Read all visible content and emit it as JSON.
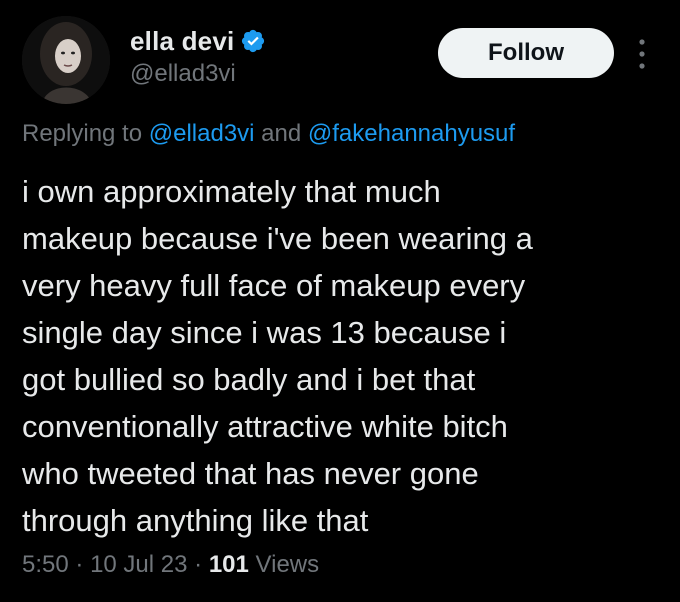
{
  "user": {
    "display_name": "ella devi",
    "handle": "@ellad3vi",
    "verified": true
  },
  "follow_label": "Follow",
  "reply_context": {
    "prefix": "Replying to",
    "mention_1": "@ellad3vi",
    "joiner": "and",
    "mention_2": "@fakehannahyusuf"
  },
  "tweet_lines": [
    "i own approximately that much",
    "makeup because i've been wearing a",
    "very heavy full face of makeup every",
    "single day since i was 13 because i",
    "got bullied so badly and i bet that",
    "conventionally attractive white bitch",
    "who tweeted that has never gone",
    "through anything like that"
  ],
  "meta": {
    "time": "5:50",
    "sep1": "·",
    "date": "10 Jul 23",
    "sep2": "·",
    "views_count": "101",
    "views_label": "Views"
  },
  "colors": {
    "background": "#000000",
    "text": "#e7e9ea",
    "secondary": "#71767b",
    "accent": "#1d9bf0",
    "follow_bg": "#eff3f4"
  },
  "icons": {
    "verified": "verified-badge-icon",
    "more": "more-options-icon"
  }
}
